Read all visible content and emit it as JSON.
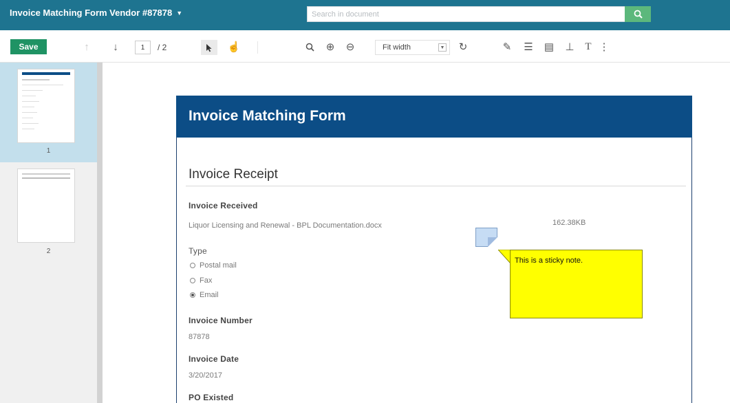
{
  "app": {
    "title": "Invoice Matching Form Vendor #87878",
    "search_placeholder": "Search in document",
    "icons": {
      "caret": "caret-down-icon",
      "search": "search-icon"
    }
  },
  "toolbar": {
    "save_label": "Save",
    "page_current": "1",
    "page_total": "/ 2",
    "zoom_value": "Fit width",
    "icons": [
      "arrow-up-icon",
      "arrow-down-icon",
      "select-cursor-icon",
      "pan-hand-icon",
      "search-icon",
      "zoom-in-icon",
      "zoom-out-icon",
      "rotate-icon",
      "highlight-icon",
      "text-edit-icon",
      "note-icon",
      "stamp-icon",
      "text-tool-icon",
      "more-icon"
    ]
  },
  "thumbnails": [
    {
      "label": "1",
      "selected": true
    },
    {
      "label": "2",
      "selected": false
    }
  ],
  "form": {
    "title": "Invoice Matching Form",
    "section_title": "Invoice Receipt",
    "fields": {
      "invoice_received_label": "Invoice Received",
      "invoice_received_file": "Liquor Licensing and Renewal - BPL Documentation.docx",
      "invoice_received_size": "162.38KB",
      "type_label": "Type",
      "type_options": [
        "Postal mail",
        "Fax",
        "Email"
      ],
      "type_selected": "Email",
      "invoice_number_label": "Invoice Number",
      "invoice_number_value": "87878",
      "invoice_date_label": "Invoice Date",
      "invoice_date_value": "3/20/2017",
      "po_existed_label": "PO Existed"
    }
  },
  "sticky_note": {
    "text": "This is a sticky note.",
    "color": "#ffff00",
    "icon": "sticky-note-icon"
  },
  "colors": {
    "title_bar": "#1e7490",
    "save_button": "#1f9364",
    "search_button": "#5cb87c",
    "form_header": "#0c4d86",
    "thumb_selected": "#c3dfec"
  }
}
